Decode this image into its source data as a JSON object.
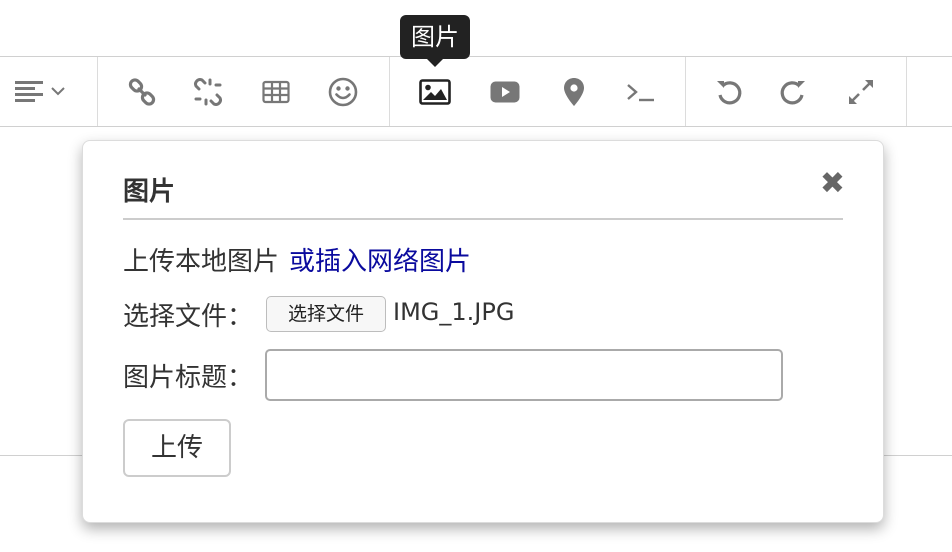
{
  "tooltip": {
    "text": "图片"
  },
  "toolbar": {
    "align_icon": "align-left-icon",
    "align_dropdown_icon": "chevron-down-icon",
    "link_icon": "link-icon",
    "unlink_icon": "unlink-icon",
    "table_icon": "table-icon",
    "emoji_icon": "smiley-icon",
    "image_icon": "image-icon",
    "video_icon": "video-icon",
    "location_icon": "map-pin-icon",
    "code_icon": "terminal-icon",
    "undo_icon": "undo-icon",
    "redo_icon": "redo-icon",
    "fullscreen_icon": "expand-icon"
  },
  "dialog": {
    "title": "图片",
    "close_icon": "✖",
    "upload_local_text": "上传本地图片",
    "insert_network_link": "或插入网络图片",
    "choose_file_label": "选择文件：",
    "choose_file_button": "选择文件",
    "file_name": "IMG_1.JPG",
    "image_title_label": "图片标题：",
    "image_title_value": "",
    "upload_button": "上传"
  },
  "colors": {
    "icon": "#777777",
    "link": "#0a0a9e",
    "tooltip_bg": "#222222"
  }
}
